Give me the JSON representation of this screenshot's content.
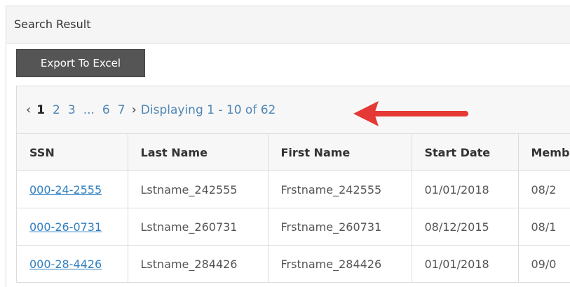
{
  "panel": {
    "title": "Search Result"
  },
  "toolbar": {
    "export_label": "Export To Excel"
  },
  "pager": {
    "prev_icon": "‹",
    "next_icon": "›",
    "pages": [
      "1",
      "2",
      "3",
      "6",
      "7"
    ],
    "current_page": "1",
    "ellipsis": "...",
    "status": "Displaying 1 - 10 of 62"
  },
  "table": {
    "columns": [
      "SSN",
      "Last Name",
      "First Name",
      "Start Date",
      "Member Date"
    ],
    "rows": [
      [
        "000-24-2555",
        "Lstname_242555",
        "Frstname_242555",
        "01/01/2018",
        "08/2"
      ],
      [
        "000-26-0731",
        "Lstname_260731",
        "Frstname_260731",
        "08/12/2015",
        "08/1"
      ],
      [
        "000-28-4426",
        "Lstname_284426",
        "Frstname_284426",
        "01/01/2018",
        "09/0"
      ]
    ]
  },
  "annotation": {
    "arrow_color": "#e53935"
  },
  "colors": {
    "link": "#2f7fc1",
    "button_bg": "#555555"
  }
}
